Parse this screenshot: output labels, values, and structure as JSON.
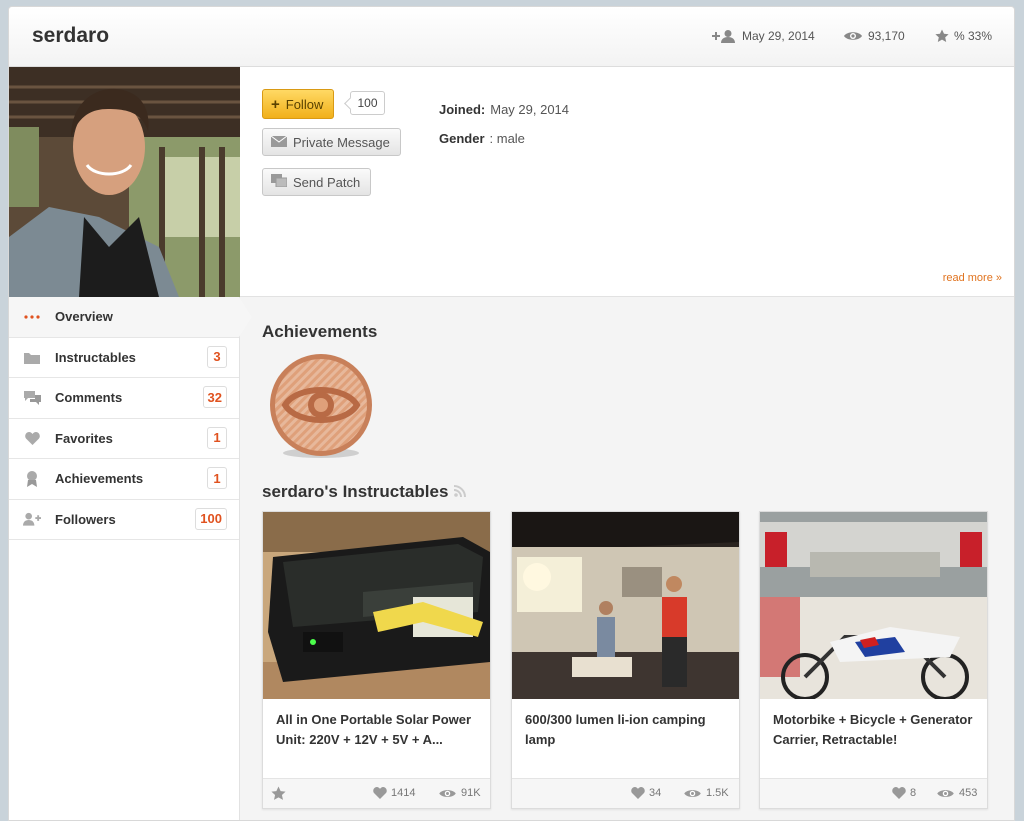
{
  "header": {
    "username": "serdaro",
    "joined_date": "May 29, 2014",
    "views": "93,170",
    "rating": "% 33%"
  },
  "profile": {
    "follow_label": "Follow",
    "follow_count": "100",
    "message_label": "Private Message",
    "patch_label": "Send Patch",
    "joined_label": "Joined:",
    "joined_value": "May 29, 2014",
    "gender_label": "Gender",
    "gender_value": ": male",
    "read_more": "read more »"
  },
  "sidebar": {
    "items": [
      {
        "label": "Overview",
        "count": null,
        "icon": "dots-icon"
      },
      {
        "label": "Instructables",
        "count": "3",
        "icon": "folder-icon"
      },
      {
        "label": "Comments",
        "count": "32",
        "icon": "comments-icon"
      },
      {
        "label": "Favorites",
        "count": "1",
        "icon": "heart-icon"
      },
      {
        "label": "Achievements",
        "count": "1",
        "icon": "ribbon-icon"
      },
      {
        "label": "Followers",
        "count": "100",
        "icon": "followers-icon"
      }
    ]
  },
  "main": {
    "achievements_title": "Achievements",
    "instructables_title": "serdaro's Instructables",
    "cards": [
      {
        "title": "All in One Portable Solar Power Unit: 220V + 12V + 5V + A...",
        "likes": "1414",
        "views": "91K"
      },
      {
        "title": "600/300 lumen li-ion camping lamp",
        "likes": "34",
        "views": "1.5K"
      },
      {
        "title": "Motorbike + Bicycle + Generator Carrier, Retractable!",
        "likes": "8",
        "views": "453"
      }
    ]
  },
  "colors": {
    "accent_orange": "#e0521f",
    "follow_yellow": "#f1b01a",
    "medal_bronze": "#d9956a"
  }
}
